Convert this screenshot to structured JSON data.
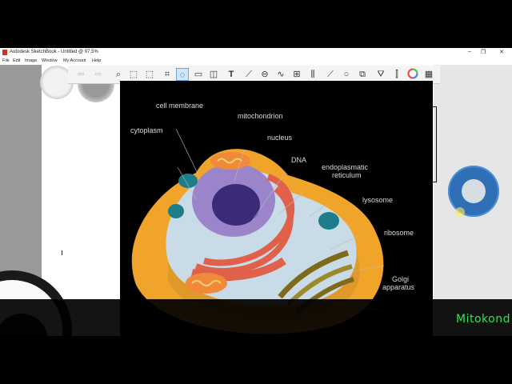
{
  "window": {
    "title": "Autodesk SketchBook - Untitled @ 97,5%",
    "controls": [
      "–",
      "❐",
      "✕"
    ]
  },
  "menu": [
    "File",
    "Edit",
    "Image",
    "Window",
    "My Account",
    "Help"
  ],
  "toolbar": {
    "icons": [
      "undo-icon",
      "redo-icon",
      "zoom-icon",
      "select-rect-icon",
      "transform-icon",
      "crop-icon",
      "lasso-select-icon",
      "perspective-icon",
      "distort-icon",
      "text-icon",
      "ruler-icon",
      "ellipse-guide-icon",
      "french-curve-icon",
      "perspective-grid-icon",
      "symmetry-icon",
      "line-icon",
      "curve-icon",
      "shape-icon",
      "fill-icon",
      "brush-icon",
      "color-wheel-icon",
      "layers-icon"
    ],
    "selected": "lasso-select-icon"
  },
  "subtoolbar": {
    "icons": [
      "rect-select-icon",
      "lasso-icon",
      "magic-wand-icon"
    ],
    "selected": "magic-wand-icon"
  },
  "diagram": {
    "labels": {
      "cell_membrane": "cell membrane",
      "mitochondrion": "mitochondrion",
      "cytoplasm": "cytoplasm",
      "nucleus": "nucleus",
      "dna": "DNA",
      "er_line1": "endoplasmatic",
      "er_line2": "reticulum",
      "lysosome": "lysosome",
      "ribosome": "ribosome",
      "golgi_line1": "Golgi",
      "golgi_line2": "apparatus"
    },
    "colors": {
      "outer_cell": "#f0a52a",
      "cytoplasm": "#c9dbe6",
      "nucleus": "#9b84c9",
      "nucleolus": "#3b2a7a",
      "er": "#e0604a",
      "mitochondria": "#f08a3a",
      "lysosome": "#1d7d8a",
      "golgi": "#7d6a1a"
    }
  },
  "caption": "Mitokond"
}
